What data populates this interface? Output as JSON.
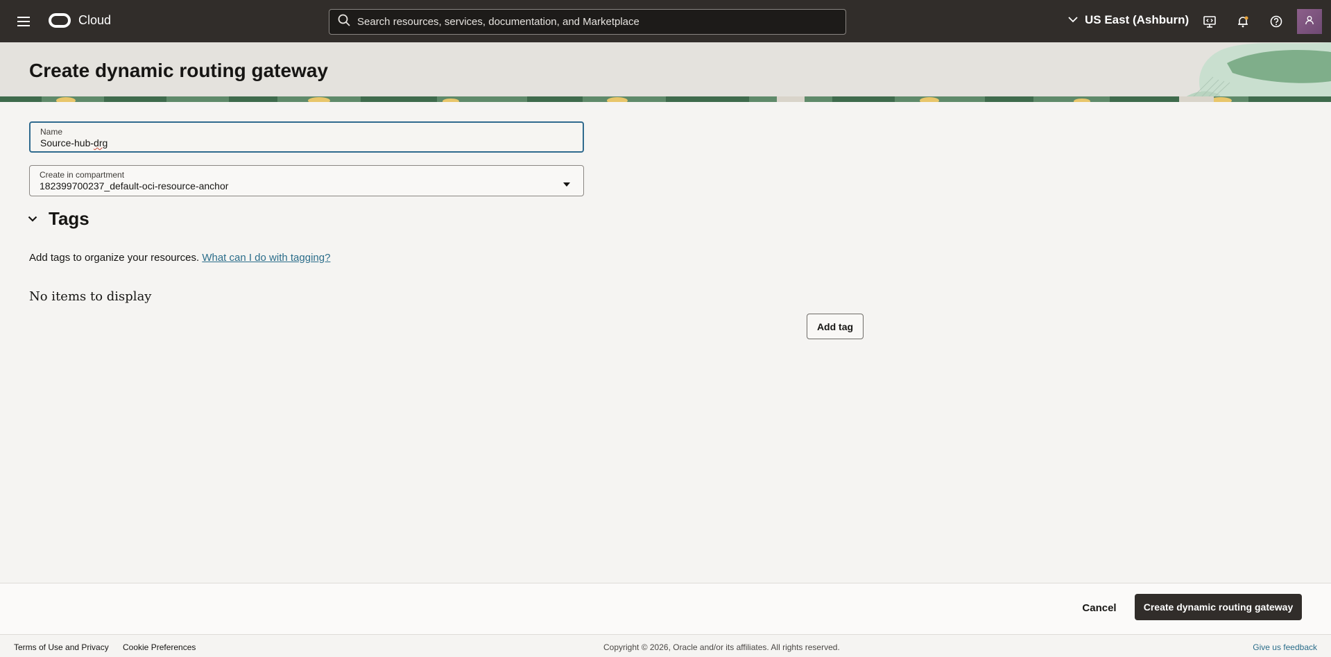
{
  "topbar": {
    "brand": "Cloud",
    "search_placeholder": "Search resources, services, documentation, and Marketplace",
    "region": "US East (Ashburn)"
  },
  "header": {
    "title": "Create dynamic routing gateway"
  },
  "form": {
    "name": {
      "label": "Name",
      "value_prefix": "Source-hub-",
      "value_misspelled": "drg"
    },
    "compartment": {
      "label": "Create in compartment",
      "value": "182399700237_default-oci-resource-anchor"
    }
  },
  "tags": {
    "title": "Tags",
    "description": "Add tags to organize your resources.",
    "help_link": "What can I do with tagging?",
    "empty_text": "No items to display",
    "add_button": "Add tag"
  },
  "actions": {
    "cancel": "Cancel",
    "submit": "Create dynamic routing gateway"
  },
  "footer": {
    "terms": "Terms of Use and Privacy",
    "cookies": "Cookie Preferences",
    "copyright": "Copyright © 2026, Oracle and/or its affiliates. All rights reserved.",
    "feedback": "Give us feedback"
  },
  "colors": {
    "topbar_bg": "#312d2a",
    "banner_bg": "#e4e2dd",
    "link": "#2b6d8a",
    "primary_button": "#312d2a",
    "focus_border": "#2f6a8e"
  },
  "icons": [
    "hamburger-menu-icon",
    "oracle-logo-icon",
    "search-icon",
    "chevron-down-icon",
    "developer-tools-icon",
    "bell-icon",
    "help-icon",
    "user-icon"
  ]
}
